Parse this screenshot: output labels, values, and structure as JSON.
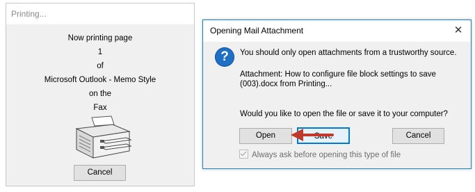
{
  "printing_dialog": {
    "title": "Printing...",
    "lines": [
      "Now printing page",
      "1",
      "of",
      "Microsoft Outlook - Memo Style",
      "on the",
      "Fax"
    ],
    "cancel_label": "Cancel"
  },
  "attachment_dialog": {
    "title": "Opening Mail Attachment",
    "close_icon": "close-icon",
    "question_icon": "question-icon",
    "message": "You should only open attachments from a trustworthy source.",
    "attachment_line1": "Attachment: How to configure file block settings to save",
    "attachment_line2": "(003).docx from Printing...",
    "question": "Would you like to open the file or save it to your computer?",
    "open_label": "Open",
    "save_label": "Save",
    "cancel_label": "Cancel",
    "always_ask_label": "Always ask before opening this type of file",
    "always_ask_checked": true
  },
  "colors": {
    "dialog_border_accent": "#1883d7",
    "arrow": "#c0392b",
    "question_icon": "#1f6fc5"
  }
}
